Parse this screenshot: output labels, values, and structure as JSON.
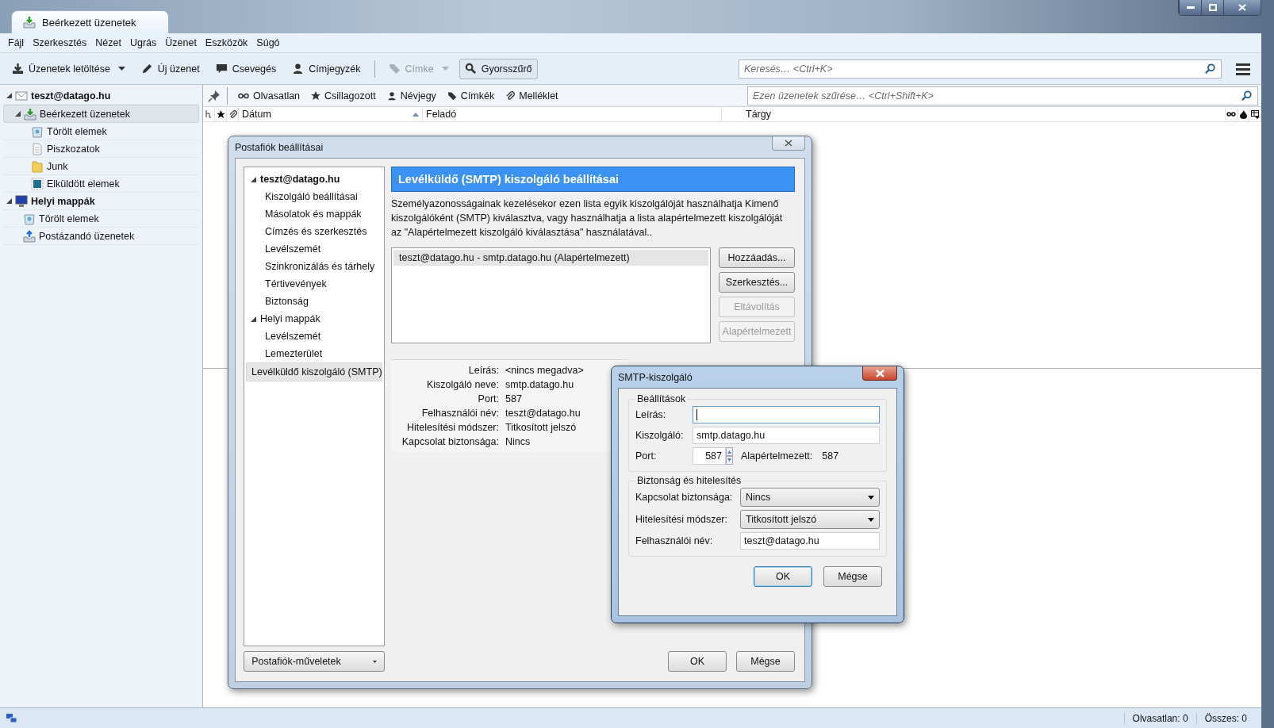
{
  "window": {
    "tab_title": "Beérkezett üzenetek"
  },
  "menu": [
    "Fájl",
    "Szerkesztés",
    "Nézet",
    "Ugrás",
    "Üzenet",
    "Eszközök",
    "Súgó"
  ],
  "toolbar": {
    "buttons": [
      {
        "label": "Üzenetek letöltése",
        "kind": "download",
        "dropdown": true,
        "disabled": false,
        "selected": false
      },
      {
        "label": "Új üzenet",
        "kind": "compose",
        "dropdown": false,
        "disabled": false,
        "selected": false
      },
      {
        "label": "Csevegés",
        "kind": "chat",
        "dropdown": false,
        "disabled": false,
        "selected": false
      },
      {
        "label": "Címjegyzék",
        "kind": "contacts",
        "dropdown": false,
        "disabled": false,
        "selected": false
      },
      {
        "label": "Címke",
        "kind": "tag",
        "dropdown": true,
        "disabled": true,
        "selected": false
      },
      {
        "label": "Gyorsszűrő",
        "kind": "quickfilter",
        "dropdown": false,
        "disabled": false,
        "selected": true
      }
    ],
    "search": {
      "placeholder": "Keresés… <Ctrl+K>"
    }
  },
  "folders": [
    {
      "label": "teszt@datago.hu",
      "kind": "account",
      "bold": true,
      "expanded": true,
      "selected": false,
      "children": [
        {
          "label": "Beérkezett üzenetek",
          "kind": "inbox",
          "bold": false,
          "expanded": true,
          "selected": true,
          "children": [
            {
              "label": "Törölt elemek",
              "kind": "trash",
              "bold": false,
              "selected": false
            },
            {
              "label": "Piszkozatok",
              "kind": "drafts",
              "bold": false,
              "selected": false
            },
            {
              "label": "Junk",
              "kind": "junk",
              "bold": false,
              "selected": false
            },
            {
              "label": "Elküldött elemek",
              "kind": "sent",
              "bold": false,
              "selected": false
            }
          ]
        }
      ]
    },
    {
      "label": "Helyi mappák",
      "kind": "local",
      "bold": true,
      "expanded": true,
      "selected": false,
      "children": [
        {
          "label": "Törölt elemek",
          "kind": "trash",
          "bold": false,
          "selected": false
        },
        {
          "label": "Postázandó üzenetek",
          "kind": "outbox",
          "bold": false,
          "selected": false
        }
      ]
    }
  ],
  "quick_filter": {
    "buttons": [
      {
        "label": "Olvasatlan",
        "kind": "unread",
        "selected": false
      },
      {
        "label": "Csillagozott",
        "kind": "starred",
        "selected": false
      },
      {
        "label": "Névjegy",
        "kind": "contact",
        "selected": false
      },
      {
        "label": "Címkék",
        "kind": "tags",
        "selected": false
      },
      {
        "label": "Melléklet",
        "kind": "attachment",
        "selected": false
      }
    ],
    "placeholder": "Ezen üzenetek szűrése… <Ctrl+Shift+K>"
  },
  "columns": [
    {
      "kind": "thread"
    },
    {
      "kind": "star"
    },
    {
      "kind": "attachment"
    },
    {
      "kind": "date",
      "label": "Dátum",
      "sorted": true
    },
    {
      "kind": "sender",
      "label": "Feladó",
      "sorted": false
    },
    {
      "kind": "subject",
      "label": "Tárgy",
      "sorted": false
    },
    {
      "kind": "read"
    },
    {
      "kind": "junk"
    },
    {
      "kind": "picker"
    }
  ],
  "account_dialog": {
    "title": "Postafiók beállításai",
    "tree": [
      {
        "label": "teszt@datago.hu",
        "bold": true,
        "expanded": true,
        "selected": false,
        "children": [
          {
            "label": "Kiszolgáló beállításai",
            "selected": false
          },
          {
            "label": "Másolatok és mappák",
            "selected": false
          },
          {
            "label": "Címzés és szerkesztés",
            "selected": false
          },
          {
            "label": "Levélszemét",
            "selected": false
          },
          {
            "label": "Szinkronizálás és tárhely",
            "selected": false
          },
          {
            "label": "Tértivevények",
            "selected": false
          },
          {
            "label": "Biztonság",
            "selected": false
          }
        ]
      },
      {
        "label": "Helyi mappák",
        "bold": false,
        "expanded": true,
        "selected": false,
        "children": [
          {
            "label": "Levélszemét",
            "selected": false
          },
          {
            "label": "Lemezterület",
            "selected": false
          }
        ]
      },
      {
        "label": "Levélküldő kiszolgáló (SMTP)",
        "bold": false,
        "selected": true
      }
    ],
    "actions_button": "Postafiók-műveletek",
    "heading": "Levélküldő (SMTP) kiszolgáló beállításai",
    "description": "Személyazonosságainak kezelésekor ezen lista egyik kiszolgálóját használhatja Kimenő kiszolgálóként (SMTP) kiválasztva, vagy használhatja a lista alapértelmezett kiszolgálóját az \"Alapértelmezett kiszolgáló kiválasztása\" használatával..",
    "servers": [
      {
        "label": "teszt@datago.hu - smtp.datago.hu (Alapértelmezett)",
        "selected": true
      }
    ],
    "server_buttons": [
      {
        "label": "Hozzáadás...",
        "disabled": false
      },
      {
        "label": "Szerkesztés...",
        "disabled": false
      },
      {
        "label": "Eltávolítás",
        "disabled": true
      },
      {
        "label": "Alapértelmezett",
        "disabled": true
      }
    ],
    "details": [
      {
        "label": "Leírás:",
        "value": "<nincs megadva>"
      },
      {
        "label": "Kiszolgáló neve:",
        "value": "smtp.datago.hu"
      },
      {
        "label": "Port:",
        "value": "587"
      },
      {
        "label": "Felhasználói név:",
        "value": "teszt@datago.hu"
      },
      {
        "label": "Hitelesítési módszer:",
        "value": "Titkosított jelszó"
      },
      {
        "label": "Kapcsolat biztonsága:",
        "value": "Nincs"
      }
    ],
    "ok": "OK",
    "cancel": "Mégse"
  },
  "smtp_dialog": {
    "title": "SMTP-kiszolgáló",
    "settings": {
      "legend": "Beállítások",
      "description": {
        "label": "Leírás:",
        "focused": true
      },
      "server": {
        "label": "Kiszolgáló:",
        "value": "smtp.datago.hu"
      },
      "port": {
        "label": "Port:",
        "value": "587",
        "default_label": "Alapértelmezett:",
        "default_value": "587"
      }
    },
    "security": {
      "legend": "Biztonság és hitelesítés",
      "fields": [
        {
          "label": "Kapcsolat biztonsága:",
          "kind": "select",
          "value": "Nincs"
        },
        {
          "label": "Hitelesítési módszer:",
          "kind": "select",
          "value": "Titkosított jelszó"
        },
        {
          "label": "Felhasználói név:",
          "kind": "text",
          "value": "teszt@datago.hu"
        }
      ]
    },
    "ok": "OK",
    "cancel": "Mégse"
  },
  "status_bar": {
    "unread": "Olvasatlan: 0",
    "total": "Összes: 0"
  }
}
